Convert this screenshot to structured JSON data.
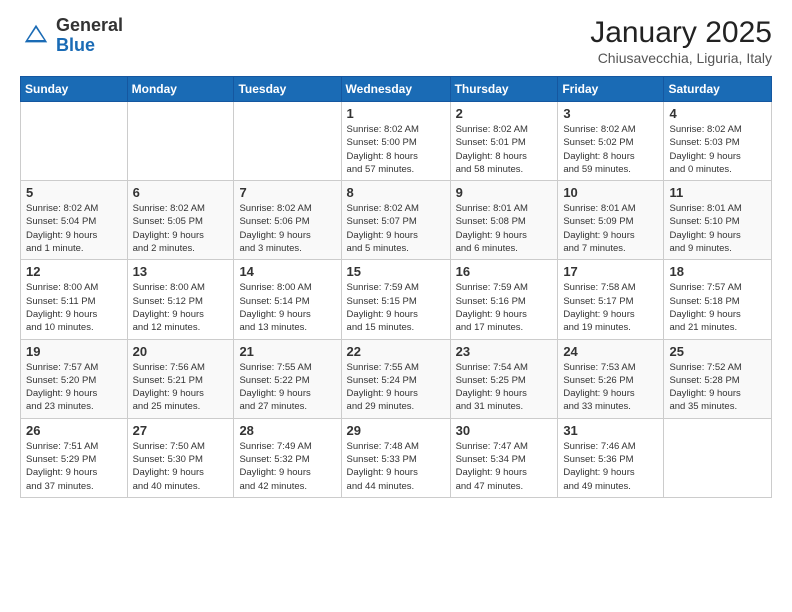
{
  "logo": {
    "text_general": "General",
    "text_blue": "Blue"
  },
  "header": {
    "month": "January 2025",
    "location": "Chiusavecchia, Liguria, Italy"
  },
  "weekdays": [
    "Sunday",
    "Monday",
    "Tuesday",
    "Wednesday",
    "Thursday",
    "Friday",
    "Saturday"
  ],
  "weeks": [
    [
      {
        "day": "",
        "info": ""
      },
      {
        "day": "",
        "info": ""
      },
      {
        "day": "",
        "info": ""
      },
      {
        "day": "1",
        "info": "Sunrise: 8:02 AM\nSunset: 5:00 PM\nDaylight: 8 hours\nand 57 minutes."
      },
      {
        "day": "2",
        "info": "Sunrise: 8:02 AM\nSunset: 5:01 PM\nDaylight: 8 hours\nand 58 minutes."
      },
      {
        "day": "3",
        "info": "Sunrise: 8:02 AM\nSunset: 5:02 PM\nDaylight: 8 hours\nand 59 minutes."
      },
      {
        "day": "4",
        "info": "Sunrise: 8:02 AM\nSunset: 5:03 PM\nDaylight: 9 hours\nand 0 minutes."
      }
    ],
    [
      {
        "day": "5",
        "info": "Sunrise: 8:02 AM\nSunset: 5:04 PM\nDaylight: 9 hours\nand 1 minute."
      },
      {
        "day": "6",
        "info": "Sunrise: 8:02 AM\nSunset: 5:05 PM\nDaylight: 9 hours\nand 2 minutes."
      },
      {
        "day": "7",
        "info": "Sunrise: 8:02 AM\nSunset: 5:06 PM\nDaylight: 9 hours\nand 3 minutes."
      },
      {
        "day": "8",
        "info": "Sunrise: 8:02 AM\nSunset: 5:07 PM\nDaylight: 9 hours\nand 5 minutes."
      },
      {
        "day": "9",
        "info": "Sunrise: 8:01 AM\nSunset: 5:08 PM\nDaylight: 9 hours\nand 6 minutes."
      },
      {
        "day": "10",
        "info": "Sunrise: 8:01 AM\nSunset: 5:09 PM\nDaylight: 9 hours\nand 7 minutes."
      },
      {
        "day": "11",
        "info": "Sunrise: 8:01 AM\nSunset: 5:10 PM\nDaylight: 9 hours\nand 9 minutes."
      }
    ],
    [
      {
        "day": "12",
        "info": "Sunrise: 8:00 AM\nSunset: 5:11 PM\nDaylight: 9 hours\nand 10 minutes."
      },
      {
        "day": "13",
        "info": "Sunrise: 8:00 AM\nSunset: 5:12 PM\nDaylight: 9 hours\nand 12 minutes."
      },
      {
        "day": "14",
        "info": "Sunrise: 8:00 AM\nSunset: 5:14 PM\nDaylight: 9 hours\nand 13 minutes."
      },
      {
        "day": "15",
        "info": "Sunrise: 7:59 AM\nSunset: 5:15 PM\nDaylight: 9 hours\nand 15 minutes."
      },
      {
        "day": "16",
        "info": "Sunrise: 7:59 AM\nSunset: 5:16 PM\nDaylight: 9 hours\nand 17 minutes."
      },
      {
        "day": "17",
        "info": "Sunrise: 7:58 AM\nSunset: 5:17 PM\nDaylight: 9 hours\nand 19 minutes."
      },
      {
        "day": "18",
        "info": "Sunrise: 7:57 AM\nSunset: 5:18 PM\nDaylight: 9 hours\nand 21 minutes."
      }
    ],
    [
      {
        "day": "19",
        "info": "Sunrise: 7:57 AM\nSunset: 5:20 PM\nDaylight: 9 hours\nand 23 minutes."
      },
      {
        "day": "20",
        "info": "Sunrise: 7:56 AM\nSunset: 5:21 PM\nDaylight: 9 hours\nand 25 minutes."
      },
      {
        "day": "21",
        "info": "Sunrise: 7:55 AM\nSunset: 5:22 PM\nDaylight: 9 hours\nand 27 minutes."
      },
      {
        "day": "22",
        "info": "Sunrise: 7:55 AM\nSunset: 5:24 PM\nDaylight: 9 hours\nand 29 minutes."
      },
      {
        "day": "23",
        "info": "Sunrise: 7:54 AM\nSunset: 5:25 PM\nDaylight: 9 hours\nand 31 minutes."
      },
      {
        "day": "24",
        "info": "Sunrise: 7:53 AM\nSunset: 5:26 PM\nDaylight: 9 hours\nand 33 minutes."
      },
      {
        "day": "25",
        "info": "Sunrise: 7:52 AM\nSunset: 5:28 PM\nDaylight: 9 hours\nand 35 minutes."
      }
    ],
    [
      {
        "day": "26",
        "info": "Sunrise: 7:51 AM\nSunset: 5:29 PM\nDaylight: 9 hours\nand 37 minutes."
      },
      {
        "day": "27",
        "info": "Sunrise: 7:50 AM\nSunset: 5:30 PM\nDaylight: 9 hours\nand 40 minutes."
      },
      {
        "day": "28",
        "info": "Sunrise: 7:49 AM\nSunset: 5:32 PM\nDaylight: 9 hours\nand 42 minutes."
      },
      {
        "day": "29",
        "info": "Sunrise: 7:48 AM\nSunset: 5:33 PM\nDaylight: 9 hours\nand 44 minutes."
      },
      {
        "day": "30",
        "info": "Sunrise: 7:47 AM\nSunset: 5:34 PM\nDaylight: 9 hours\nand 47 minutes."
      },
      {
        "day": "31",
        "info": "Sunrise: 7:46 AM\nSunset: 5:36 PM\nDaylight: 9 hours\nand 49 minutes."
      },
      {
        "day": "",
        "info": ""
      }
    ]
  ]
}
